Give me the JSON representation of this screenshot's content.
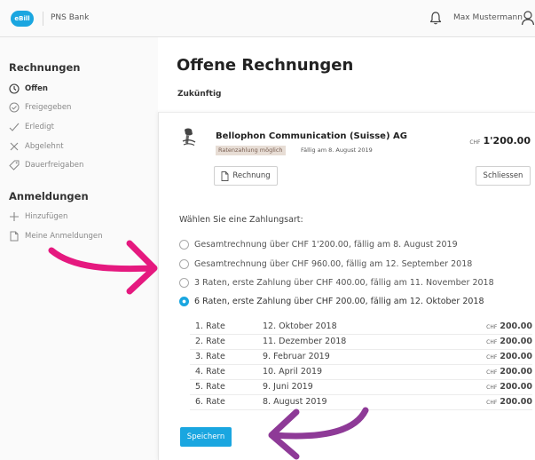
{
  "header": {
    "logo_text": "eBill",
    "bank_name": "PNS Bank",
    "user_name": "Max Mustermann",
    "bell_icon": "bell-icon",
    "user_icon": "user-icon"
  },
  "sidebar": {
    "invoices_title": "Rechnungen",
    "invoices_items": [
      {
        "label": "Offen",
        "icon": "clock-icon",
        "active": true
      },
      {
        "label": "Freigegeben",
        "icon": "clock-check-icon",
        "active": false
      },
      {
        "label": "Erledigt",
        "icon": "check-icon",
        "active": false
      },
      {
        "label": "Abgelehnt",
        "icon": "x-icon",
        "active": false
      },
      {
        "label": "Dauerfreigaben",
        "icon": "tag-icon",
        "active": false
      }
    ],
    "registrations_title": "Anmeldungen",
    "registration_items": [
      {
        "label": "Hinzufügen",
        "icon": "plus-icon"
      },
      {
        "label": "Meine Anmeldungen",
        "icon": "document-icon"
      }
    ]
  },
  "main": {
    "title": "Offene Rechnungen",
    "section": "Zukünftig"
  },
  "invoice": {
    "biller": "Bellophon Communication (Suisse) AG",
    "badge": "Ratenzahlung möglich",
    "due": "Fällig am 8. August 2019",
    "currency": "CHF",
    "amount": "1'200.00",
    "invoice_button": "Rechnung",
    "close_button": "Schliessen"
  },
  "payment": {
    "label": "Wählen Sie eine Zahlungsart:",
    "options": [
      {
        "text": "Gesamtrechnung über CHF 1'200.00, fällig am 8. August 2019",
        "selected": false
      },
      {
        "text": "Gesamtrechnung über CHF 960.00, fällig am 12. September 2018",
        "selected": false
      },
      {
        "text": "3 Raten, erste Zahlung über CHF 400.00, fällig am 11. November 2018",
        "selected": false
      },
      {
        "text": "6 Raten, erste Zahlung über CHF 200.00, fällig am 12. Oktober 2018",
        "selected": true
      }
    ],
    "rates": [
      {
        "no": "1. Rate",
        "date": "12. Oktober 2018",
        "currency": "CHF",
        "amount": "200.00"
      },
      {
        "no": "2. Rate",
        "date": "11. Dezember 2018",
        "currency": "CHF",
        "amount": "200.00"
      },
      {
        "no": "3. Rate",
        "date": "9. Februar 2019",
        "currency": "CHF",
        "amount": "200.00"
      },
      {
        "no": "4. Rate",
        "date": "10. April 2019",
        "currency": "CHF",
        "amount": "200.00"
      },
      {
        "no": "5. Rate",
        "date": "9. Juni 2019",
        "currency": "CHF",
        "amount": "200.00"
      },
      {
        "no": "6. Rate",
        "date": "8. August 2019",
        "currency": "CHF",
        "amount": "200.00"
      }
    ],
    "save_button": "Speichern"
  },
  "colors": {
    "accent": "#1aa6e0",
    "annotation_pink": "#e5197f",
    "annotation_purple": "#8e3a97"
  }
}
